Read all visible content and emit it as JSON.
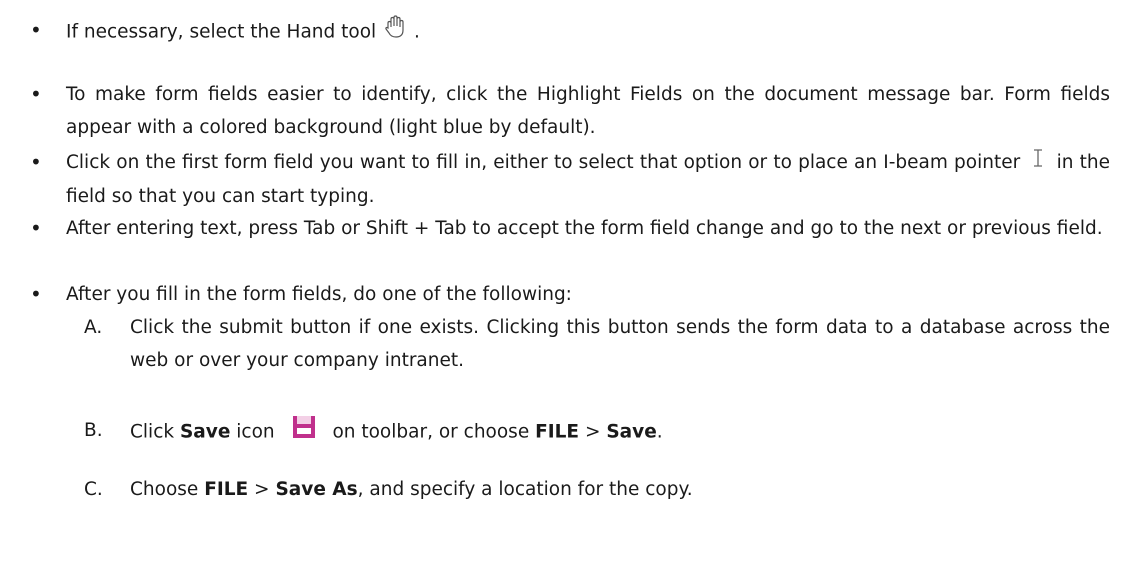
{
  "bullets": {
    "b1": {
      "before": "If necessary, select the Hand tool",
      "after": "."
    },
    "b2": {
      "text": "To make form fields easier to identify, click the Highlight Fields on the document message bar. Form fields appear with a colored background (light blue by default)."
    },
    "b3": {
      "before": "Click on the first form field you want to fill in, either to select that option or to place an I-beam pointer",
      "after": "in the field so that you can start typing."
    },
    "b4": {
      "text": "After entering text, press Tab or Shift + Tab to accept the form field change and go to the next or previous field."
    },
    "b5": {
      "text": "After you fill in the form fields, do one of the following:"
    }
  },
  "sub_items": {
    "a": {
      "letter": "A.",
      "text": "Click the submit button if one exists. Clicking this button sends the form data to a database across the web or over your company intranet."
    },
    "b": {
      "letter": "B.",
      "t1": "Click",
      "bold1": "Save",
      "t2": "icon",
      "t3": "on toolbar, or choose",
      "bold2": "FILE",
      "t4": ">",
      "bold3": "Save",
      "t5": "."
    },
    "c": {
      "letter": "C.",
      "t1": "Choose",
      "bold1": "FILE",
      "t2": ">",
      "bold2": "Save As",
      "t3": ", and specify a location for the copy."
    }
  },
  "icons": {
    "hand": "hand-tool-icon",
    "ibeam": "i-beam-pointer-icon",
    "save": "save-icon",
    "save_color": "#c0308c"
  }
}
